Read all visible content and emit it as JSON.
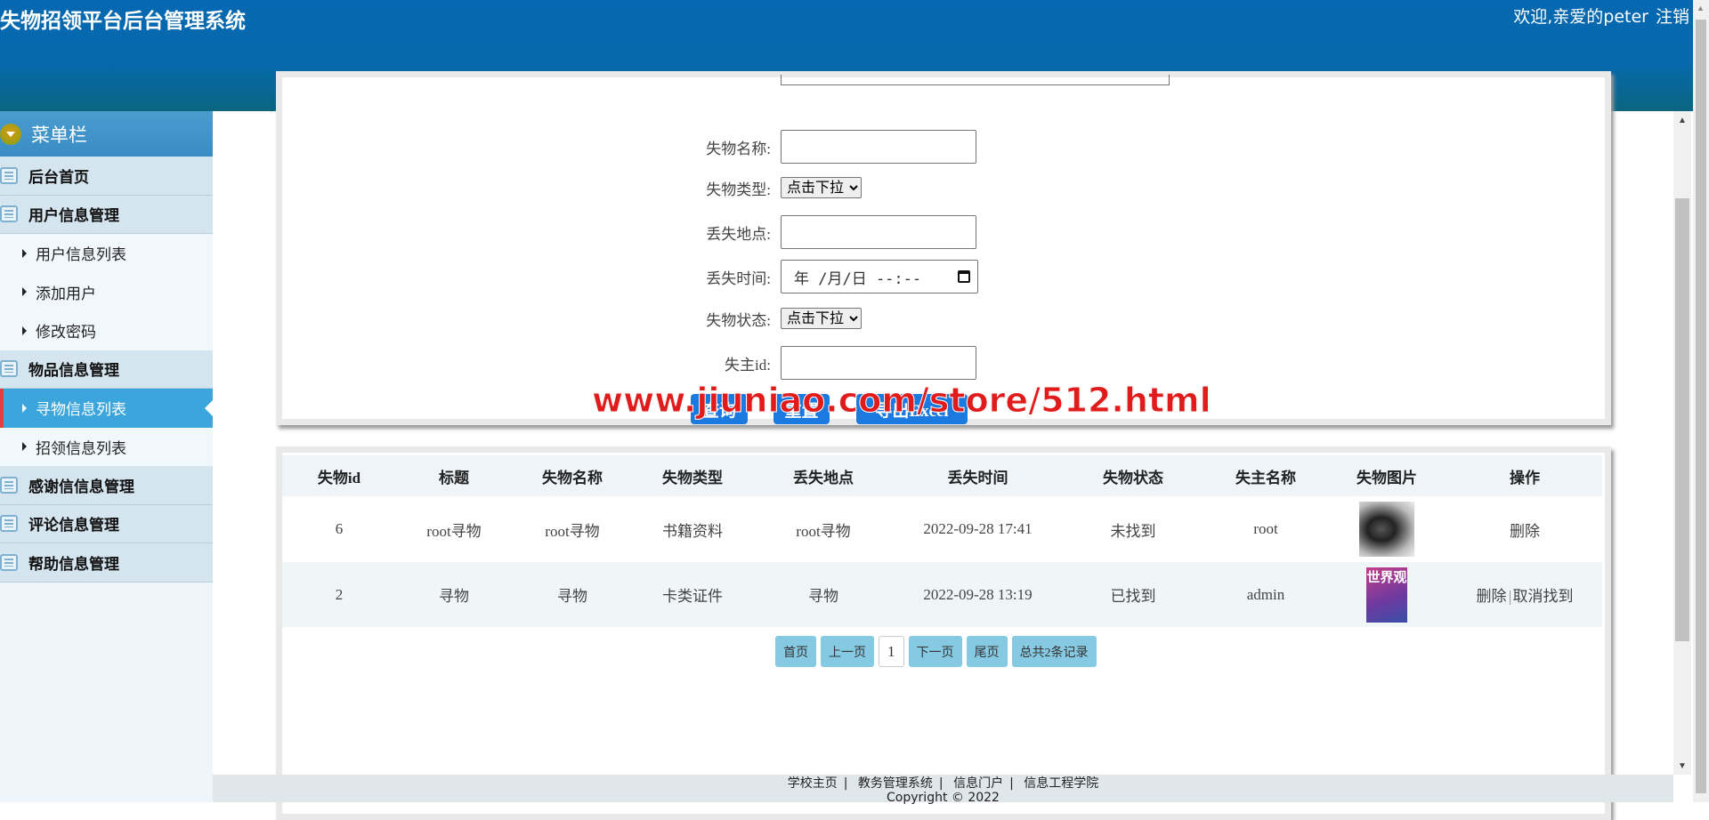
{
  "header": {
    "title": "失物招领平台后台管理系统",
    "welcome": "欢迎,亲爱的peter",
    "logout": "注销"
  },
  "sidebar": {
    "title": "菜单栏",
    "items": [
      {
        "label": "后台首页",
        "type": "group"
      },
      {
        "label": "用户信息管理",
        "type": "group"
      },
      {
        "label": "用户信息列表",
        "type": "sub"
      },
      {
        "label": "添加用户",
        "type": "sub"
      },
      {
        "label": "修改密码",
        "type": "sub"
      },
      {
        "label": "物品信息管理",
        "type": "group"
      },
      {
        "label": "寻物信息列表",
        "type": "sub",
        "active": true
      },
      {
        "label": "招领信息列表",
        "type": "sub"
      },
      {
        "label": "感谢信信息管理",
        "type": "group"
      },
      {
        "label": "评论信息管理",
        "type": "group"
      },
      {
        "label": "帮助信息管理",
        "type": "group"
      }
    ]
  },
  "form": {
    "name_label": "失物名称:",
    "name_value": "",
    "type_label": "失物类型:",
    "type_selected": "点击下拉",
    "place_label": "丢失地点:",
    "place_value": "",
    "time_label": "丢失时间:",
    "time_placeholder": "年 /月/日 --:--",
    "status_label": "失物状态:",
    "status_selected": "点击下拉",
    "owner_label": "失主id:",
    "owner_value": "",
    "query_btn": "查询",
    "reset_btn": "重置",
    "export_btn": "导出Excel"
  },
  "watermark": "www.jiuniao.com/store/512.html",
  "table": {
    "headers": [
      "失物id",
      "标题",
      "失物名称",
      "失物类型",
      "丢失地点",
      "丢失时间",
      "失物状态",
      "失主名称",
      "失物图片",
      "操作"
    ],
    "rows": [
      {
        "id": "6",
        "title": "root寻物",
        "name": "root寻物",
        "type": "书籍资料",
        "place": "root寻物",
        "time": "2022-09-28 17:41",
        "status": "未找到",
        "owner": "root",
        "ops": [
          "删除"
        ]
      },
      {
        "id": "2",
        "title": "寻物",
        "name": "寻物",
        "type": "卡类证件",
        "place": "寻物",
        "time": "2022-09-28 13:19",
        "status": "已找到",
        "owner": "admin",
        "image_text": "世界观",
        "ops": [
          "删除",
          "取消找到"
        ]
      }
    ]
  },
  "pagination": {
    "first": "首页",
    "prev": "上一页",
    "current": "1",
    "next": "下一页",
    "last": "尾页",
    "total": "总共2条记录"
  },
  "footer": {
    "links": [
      "学校主页",
      "教务管理系统",
      "信息门户",
      "信息工程学院"
    ],
    "copyright": "Copyright © 2022"
  },
  "colors": {
    "header": "#0668b0",
    "active_menu": "#3ba5dc",
    "button": "#1a7ae0",
    "pager": "#86c9e3"
  }
}
